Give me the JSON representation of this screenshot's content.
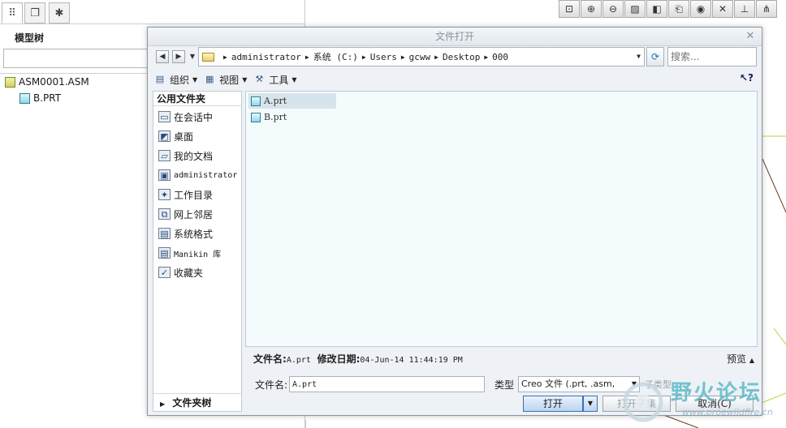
{
  "model_tree": {
    "title": "模型树",
    "items": [
      {
        "label": "ASM0001.ASM",
        "type": "asm"
      },
      {
        "label": "B.PRT",
        "type": "prt"
      }
    ]
  },
  "dialog": {
    "title": "文件打开",
    "address": [
      "administrator",
      "系统 (C:)",
      "Users",
      "gcww",
      "Desktop",
      "000"
    ],
    "search_placeholder": "搜索...",
    "tools": {
      "organize": "组织",
      "view": "视图",
      "tools": "工具"
    },
    "sidebar": {
      "header": "公用文件夹",
      "items": [
        {
          "label": "在会话中",
          "icon": "monitor-icon"
        },
        {
          "label": "桌面",
          "icon": "desktop-icon"
        },
        {
          "label": "我的文档",
          "icon": "documents-icon"
        },
        {
          "label": "administrator",
          "icon": "computer-icon"
        },
        {
          "label": "工作目录",
          "icon": "working-dir-icon"
        },
        {
          "label": "网上邻居",
          "icon": "network-icon"
        },
        {
          "label": "系统格式",
          "icon": "system-format-icon"
        },
        {
          "label": "Manikin 库",
          "icon": "manikin-library-icon"
        },
        {
          "label": "收藏夹",
          "icon": "favorites-icon"
        }
      ],
      "folder_tree": "文件夹树"
    },
    "files": [
      {
        "name": "A.prt",
        "selected": true
      },
      {
        "name": "B.prt",
        "selected": false
      }
    ],
    "info": {
      "name_label": "文件名:",
      "name_value": "A.prt",
      "date_label": "修改日期:",
      "date_value": "04-Jun-14 11:44:19 PM",
      "preview": "预览"
    },
    "filename_label": "文件名:",
    "filename_value": "A.prt",
    "type_label": "类型",
    "type_value": "Creo 文件 (.prt, .asm,",
    "subtype_label": "子类型",
    "buttons": {
      "open": "打开",
      "open_subset": "打开子集",
      "cancel": "取消(C)"
    }
  },
  "watermark": {
    "main": "野火论坛",
    "sub": "www.proewildfire.cn"
  },
  "colors": {
    "accent": "#3b6fb0",
    "file_pane": "#f3fbfd",
    "selection": "#d7e4ec"
  }
}
